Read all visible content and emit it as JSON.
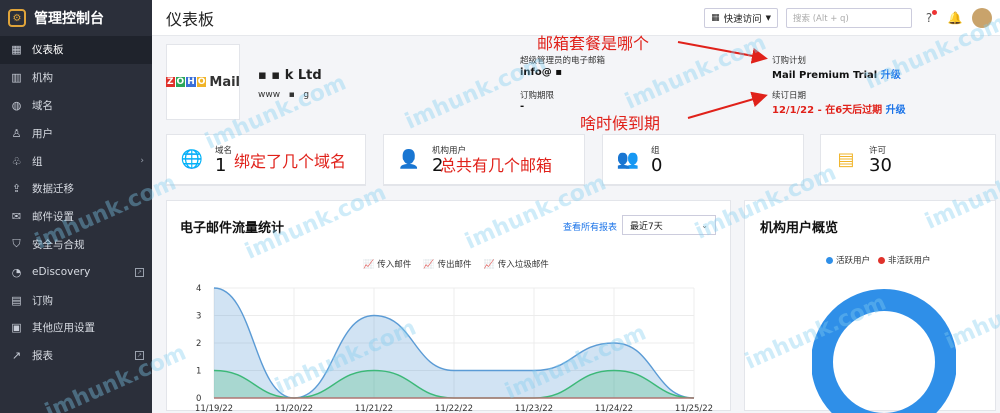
{
  "sidebar": {
    "title": "管理控制台",
    "items": [
      {
        "label": "仪表板",
        "icon": "grid-icon",
        "active": true
      },
      {
        "label": "机构",
        "icon": "building-icon"
      },
      {
        "label": "域名",
        "icon": "globe-icon"
      },
      {
        "label": "用户",
        "icon": "user-icon"
      },
      {
        "label": "组",
        "icon": "group-icon",
        "arrow": true
      },
      {
        "label": "数据迁移",
        "icon": "migration-icon"
      },
      {
        "label": "邮件设置",
        "icon": "mail-settings-icon"
      },
      {
        "label": "安全与合规",
        "icon": "shield-icon"
      },
      {
        "label": "eDiscovery",
        "icon": "ediscovery-icon",
        "external": true
      },
      {
        "label": "订购",
        "icon": "subscription-icon"
      },
      {
        "label": "其他应用设置",
        "icon": "apps-icon"
      },
      {
        "label": "报表",
        "icon": "reports-icon",
        "external": true
      }
    ]
  },
  "topbar": {
    "title": "仪表板",
    "quick_access": "快速访问",
    "search_placeholder": "搜索 (Alt + q)"
  },
  "org": {
    "logo_zoho": "ZOHO",
    "logo_mail": "Mail",
    "name": "k Ltd",
    "site": "www",
    "site_suffix": "g",
    "admin_email_label": "超级管理员的电子邮箱",
    "admin_email": "info@",
    "period_label": "订购期限",
    "period_value": "-",
    "plan_label": "订购计划",
    "plan_value": "Mail Premium Trial",
    "upgrade": "升级",
    "renew_label": "续订日期",
    "renew_value": "12/1/22 - 在6天后过期",
    "renew_upgrade": "升级"
  },
  "stats": [
    {
      "label": "域名",
      "value": "1",
      "color": "#e0322b"
    },
    {
      "label": "机构用户",
      "value": "2",
      "color": "#2aa65a"
    },
    {
      "label": "组",
      "value": "0",
      "color": "#3a6fd8"
    },
    {
      "label": "许可",
      "value": "30",
      "color": "#f0b429"
    }
  ],
  "email_panel": {
    "title": "电子邮件流量统计",
    "view_all": "查看所有报表",
    "range": "最近7天",
    "legend": [
      "传入邮件",
      "传出邮件",
      "传入垃圾邮件"
    ]
  },
  "users_panel": {
    "title": "机构用户概览",
    "legend": [
      "活跃用户",
      "非活跃用户"
    ]
  },
  "annotations": {
    "plan": "邮箱套餐是哪个",
    "expiry": "啥时候到期",
    "domains": "绑定了几个域名",
    "mailboxes": "总共有几个邮箱"
  },
  "watermark": "imhunk.com",
  "chart_data": {
    "type": "area",
    "x": [
      "11/19/22",
      "11/20/22",
      "11/21/22",
      "11/22/22",
      "11/23/22",
      "11/24/22",
      "11/25/22"
    ],
    "series": [
      {
        "name": "传入邮件",
        "values": [
          4,
          0,
          3,
          1,
          1,
          2,
          0
        ],
        "color": "#5b9bd5"
      },
      {
        "name": "传出邮件",
        "values": [
          1,
          0,
          1,
          0,
          0,
          1,
          0
        ],
        "color": "#3cb878"
      },
      {
        "name": "传入垃圾邮件",
        "values": [
          0,
          0,
          0,
          0,
          0,
          0,
          0
        ],
        "color": "#e0322b"
      }
    ],
    "yticks": [
      "0",
      "1",
      "2",
      "3",
      "4"
    ],
    "ylim": [
      0,
      4
    ],
    "grid": true,
    "legend": "top-center"
  },
  "pie_data": {
    "type": "pie",
    "values": [
      0,
      2
    ],
    "colors": [
      "#2f8fe8",
      "#e0322b"
    ]
  }
}
